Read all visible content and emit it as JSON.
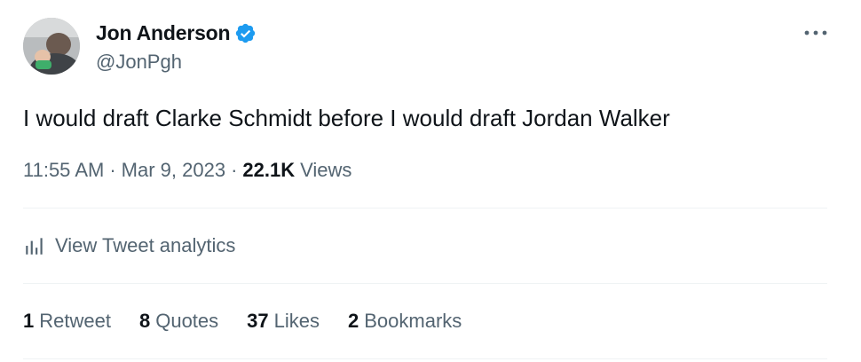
{
  "author": {
    "display_name": "Jon Anderson",
    "handle": "@JonPgh",
    "verified": true
  },
  "tweet": {
    "text": "I would draft Clarke Schmidt before I would draft Jordan Walker",
    "time": "11:55 AM",
    "date": "Mar 9, 2023",
    "views_count": "22.1K",
    "views_label": "Views",
    "separator": "·"
  },
  "analytics": {
    "label": "View Tweet analytics",
    "icon": "bar-chart-icon"
  },
  "stats": [
    {
      "count": "1",
      "label": "Retweet"
    },
    {
      "count": "8",
      "label": "Quotes"
    },
    {
      "count": "37",
      "label": "Likes"
    },
    {
      "count": "2",
      "label": "Bookmarks"
    }
  ],
  "colors": {
    "text_primary": "#0f1419",
    "text_secondary": "#536471",
    "verified_blue": "#1d9bf0",
    "divider": "#eff3f4"
  }
}
